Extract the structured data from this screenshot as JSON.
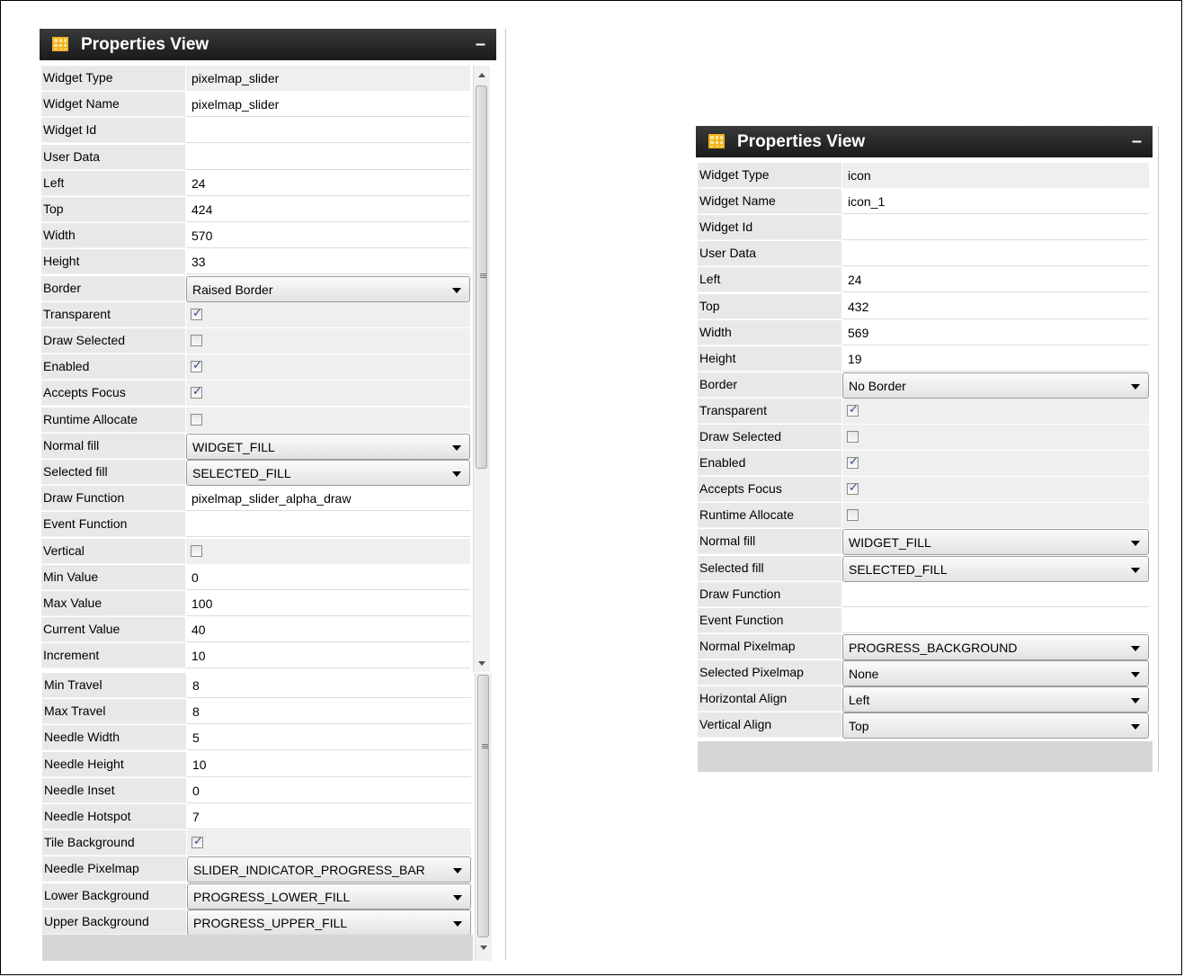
{
  "left_panel": {
    "title": "Properties View",
    "minimize": "–",
    "rows": [
      {
        "label": "Widget Type",
        "value": "pixelmap_slider",
        "kind": "readonly"
      },
      {
        "label": "Widget Name",
        "value": "pixelmap_slider",
        "kind": "input"
      },
      {
        "label": "Widget Id",
        "value": "",
        "kind": "input"
      },
      {
        "label": "User Data",
        "value": "",
        "kind": "input"
      },
      {
        "label": "Left",
        "value": "24",
        "kind": "input"
      },
      {
        "label": "Top",
        "value": "424",
        "kind": "input"
      },
      {
        "label": "Width",
        "value": "570",
        "kind": "input"
      },
      {
        "label": "Height",
        "value": "33",
        "kind": "input"
      },
      {
        "label": "Border",
        "value": "Raised Border",
        "kind": "dropdown"
      },
      {
        "label": "Transparent",
        "checked": true,
        "kind": "checkbox"
      },
      {
        "label": "Draw Selected",
        "checked": false,
        "kind": "checkbox"
      },
      {
        "label": "Enabled",
        "checked": true,
        "kind": "checkbox"
      },
      {
        "label": "Accepts Focus",
        "checked": true,
        "kind": "checkbox"
      },
      {
        "label": "Runtime Allocate",
        "checked": false,
        "kind": "checkbox"
      },
      {
        "label": "Normal fill",
        "value": "WIDGET_FILL",
        "kind": "dropdown"
      },
      {
        "label": "Selected fill",
        "value": "SELECTED_FILL",
        "kind": "dropdown"
      },
      {
        "label": "Draw Function",
        "value": "pixelmap_slider_alpha_draw",
        "kind": "input"
      },
      {
        "label": "Event Function",
        "value": "",
        "kind": "input"
      },
      {
        "label": "Vertical",
        "checked": false,
        "kind": "checkbox"
      },
      {
        "label": "Min Value",
        "value": "0",
        "kind": "input"
      },
      {
        "label": "Max Value",
        "value": "100",
        "kind": "input"
      },
      {
        "label": "Current Value",
        "value": "40",
        "kind": "input"
      },
      {
        "label": "Increment",
        "value": "10",
        "kind": "input"
      }
    ],
    "rows_continued": [
      {
        "label": "Min Travel",
        "value": "8",
        "kind": "input"
      },
      {
        "label": "Max Travel",
        "value": "8",
        "kind": "input"
      },
      {
        "label": "Needle Width",
        "value": "5",
        "kind": "input"
      },
      {
        "label": "Needle Height",
        "value": "10",
        "kind": "input"
      },
      {
        "label": "Needle Inset",
        "value": "0",
        "kind": "input"
      },
      {
        "label": "Needle Hotspot",
        "value": "7",
        "kind": "input"
      },
      {
        "label": "Tile Background",
        "checked": true,
        "kind": "checkbox"
      },
      {
        "label": "Needle Pixelmap",
        "value": "SLIDER_INDICATOR_PROGRESS_BAR",
        "kind": "dropdown"
      },
      {
        "label": "Lower Background",
        "value": "PROGRESS_LOWER_FILL",
        "kind": "dropdown"
      },
      {
        "label": "Upper Background",
        "value": "PROGRESS_UPPER_FILL",
        "kind": "dropdown"
      }
    ]
  },
  "right_panel": {
    "title": "Properties View",
    "minimize": "–",
    "rows": [
      {
        "label": "Widget Type",
        "value": "icon",
        "kind": "readonly"
      },
      {
        "label": "Widget Name",
        "value": "icon_1",
        "kind": "input"
      },
      {
        "label": "Widget Id",
        "value": "",
        "kind": "input"
      },
      {
        "label": "User Data",
        "value": "",
        "kind": "input"
      },
      {
        "label": "Left",
        "value": "24",
        "kind": "input"
      },
      {
        "label": "Top",
        "value": "432",
        "kind": "input"
      },
      {
        "label": "Width",
        "value": "569",
        "kind": "input"
      },
      {
        "label": "Height",
        "value": "19",
        "kind": "input"
      },
      {
        "label": "Border",
        "value": "No Border",
        "kind": "dropdown"
      },
      {
        "label": "Transparent",
        "checked": true,
        "kind": "checkbox"
      },
      {
        "label": "Draw Selected",
        "checked": false,
        "kind": "checkbox"
      },
      {
        "label": "Enabled",
        "checked": true,
        "kind": "checkbox"
      },
      {
        "label": "Accepts Focus",
        "checked": true,
        "kind": "checkbox"
      },
      {
        "label": "Runtime Allocate",
        "checked": false,
        "kind": "checkbox"
      },
      {
        "label": "Normal fill",
        "value": "WIDGET_FILL",
        "kind": "dropdown"
      },
      {
        "label": "Selected fill",
        "value": "SELECTED_FILL",
        "kind": "dropdown"
      },
      {
        "label": "Draw Function",
        "value": "",
        "kind": "input"
      },
      {
        "label": "Event Function",
        "value": "",
        "kind": "input"
      },
      {
        "label": "Normal Pixelmap",
        "value": "PROGRESS_BACKGROUND",
        "kind": "dropdown"
      },
      {
        "label": "Selected Pixelmap",
        "value": "None",
        "kind": "dropdown"
      },
      {
        "label": "Horizontal Align",
        "value": "Left",
        "kind": "dropdown"
      },
      {
        "label": "Vertical Align",
        "value": "Top",
        "kind": "dropdown"
      }
    ]
  },
  "icons": {
    "panel_icon": "grid-table-icon",
    "dropdown_caret": "chevron-down-icon",
    "checkbox_checked": "check-icon",
    "scroll_grip": "≡"
  },
  "colors": {
    "header_bg": "#222222",
    "label_bg": "#e8e8e8",
    "icon_accent": "#f1b51c",
    "check_color": "#2a4d8f"
  }
}
